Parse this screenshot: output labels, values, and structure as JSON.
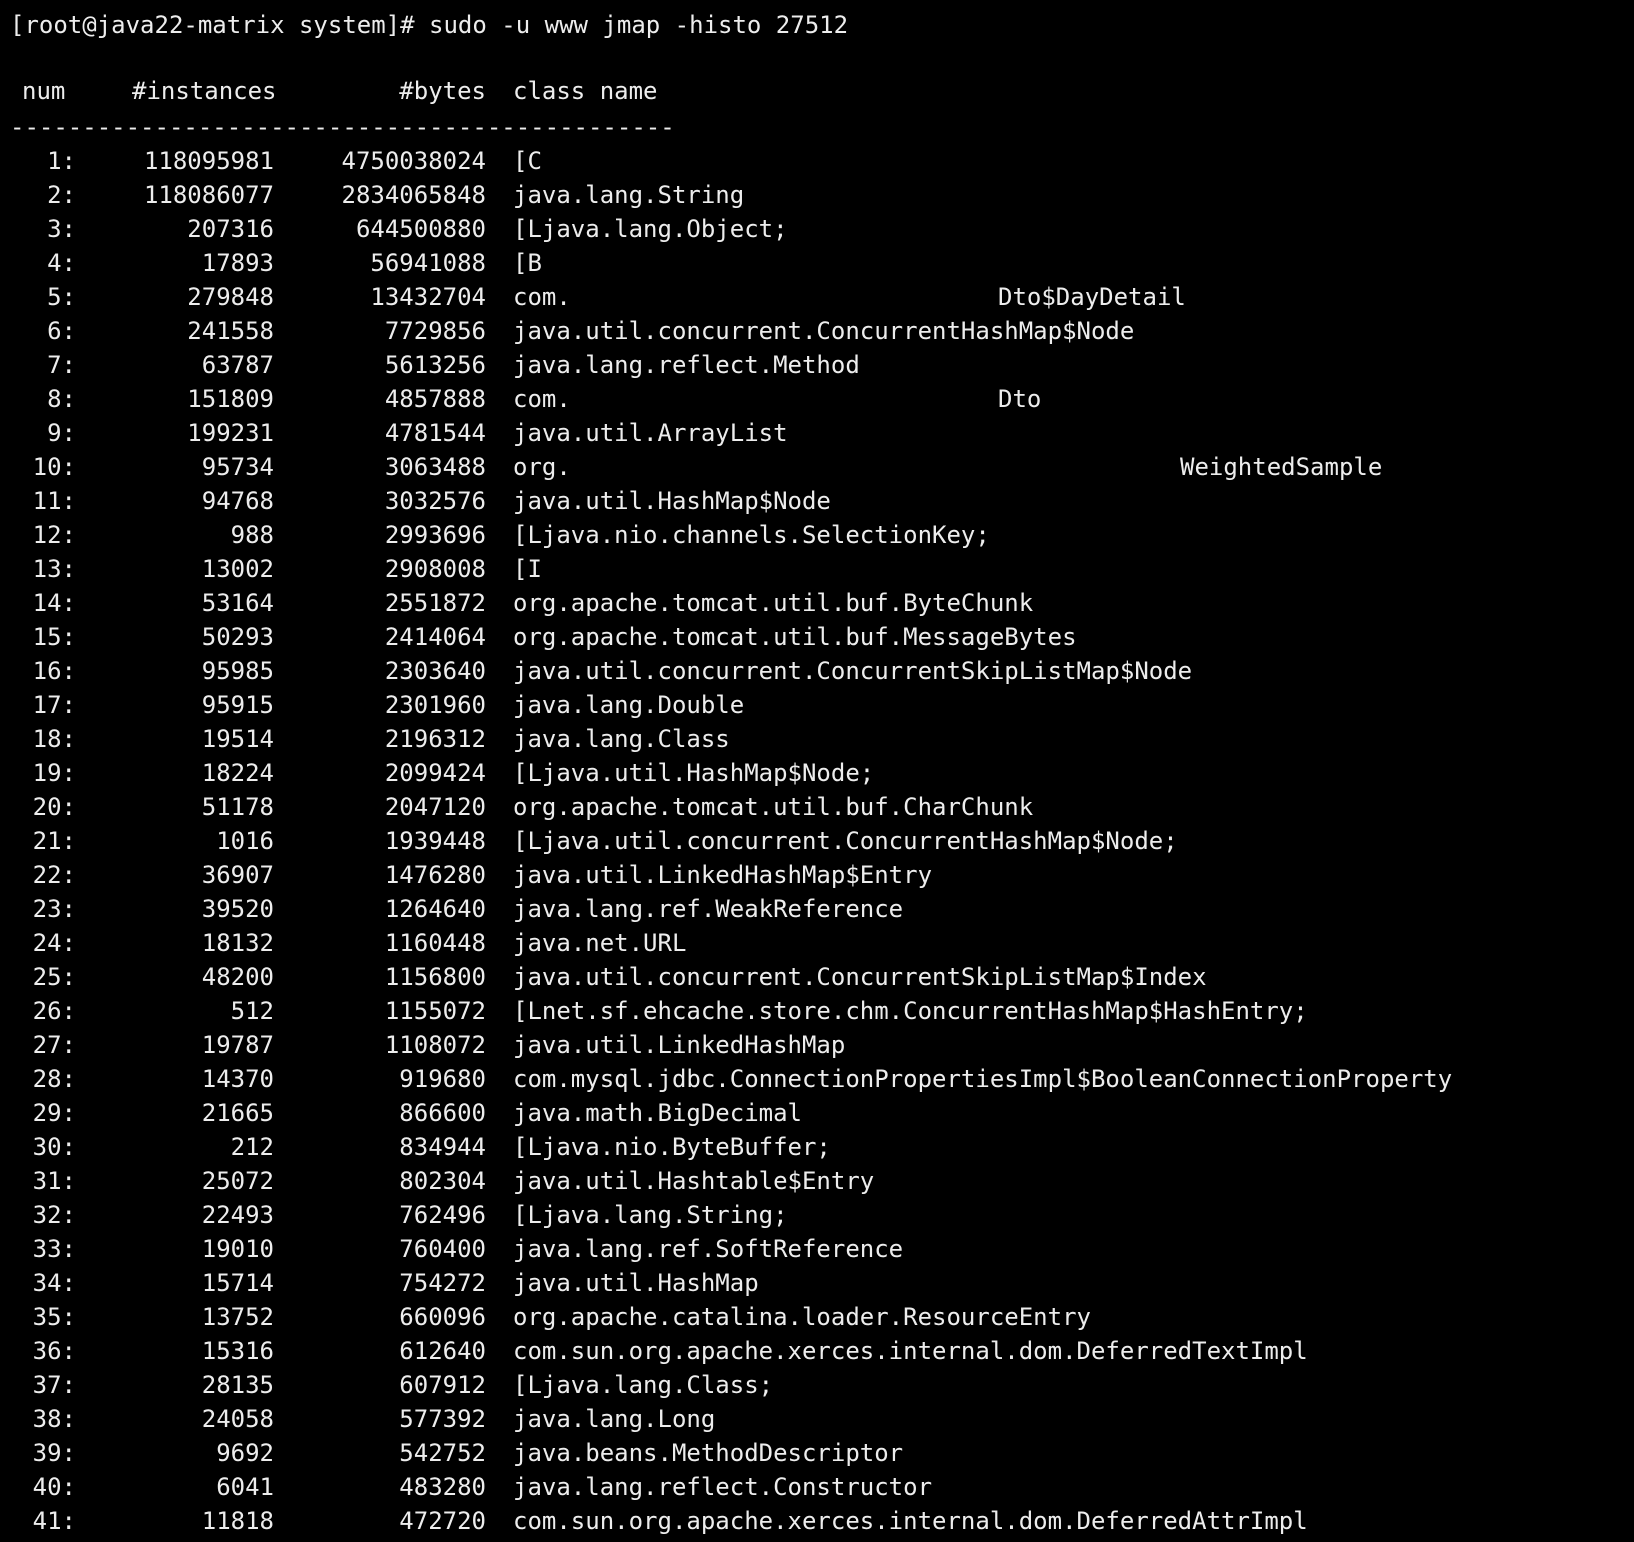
{
  "terminal": {
    "prompt": "[root@java22-matrix system]# sudo -u www jmap -histo 27512",
    "headers": {
      "num": "num",
      "instances": "#instances",
      "bytes": "#bytes",
      "class_name": "class name"
    },
    "separator": "----------------------------------------------",
    "rows": [
      {
        "num": "1:",
        "instances": "118095981",
        "bytes": "4750038024",
        "class_name": "[C"
      },
      {
        "num": "2:",
        "instances": "118086077",
        "bytes": "2834065848",
        "class_name": "java.lang.String"
      },
      {
        "num": "3:",
        "instances": "207316",
        "bytes": "644500880",
        "class_name": "[Ljava.lang.Object;"
      },
      {
        "num": "4:",
        "instances": "17893",
        "bytes": "56941088",
        "class_name": "[B"
      },
      {
        "num": "5:",
        "instances": "279848",
        "bytes": "13432704",
        "class_name": "com.",
        "class_tail": "Dto$DayDetail"
      },
      {
        "num": "6:",
        "instances": "241558",
        "bytes": "7729856",
        "class_name": "java.util.concurrent.ConcurrentHashMap$Node"
      },
      {
        "num": "7:",
        "instances": "63787",
        "bytes": "5613256",
        "class_name": "java.lang.reflect.Method"
      },
      {
        "num": "8:",
        "instances": "151809",
        "bytes": "4857888",
        "class_name": "com.",
        "class_tail": "Dto"
      },
      {
        "num": "9:",
        "instances": "199231",
        "bytes": "4781544",
        "class_name": "java.util.ArrayList"
      },
      {
        "num": "10:",
        "instances": "95734",
        "bytes": "3063488",
        "class_name": "org.",
        "class_tail": "WeightedSample"
      },
      {
        "num": "11:",
        "instances": "94768",
        "bytes": "3032576",
        "class_name": "java.util.HashMap$Node"
      },
      {
        "num": "12:",
        "instances": "988",
        "bytes": "2993696",
        "class_name": "[Ljava.nio.channels.SelectionKey;"
      },
      {
        "num": "13:",
        "instances": "13002",
        "bytes": "2908008",
        "class_name": "[I"
      },
      {
        "num": "14:",
        "instances": "53164",
        "bytes": "2551872",
        "class_name": "org.apache.tomcat.util.buf.ByteChunk"
      },
      {
        "num": "15:",
        "instances": "50293",
        "bytes": "2414064",
        "class_name": "org.apache.tomcat.util.buf.MessageBytes"
      },
      {
        "num": "16:",
        "instances": "95985",
        "bytes": "2303640",
        "class_name": "java.util.concurrent.ConcurrentSkipListMap$Node"
      },
      {
        "num": "17:",
        "instances": "95915",
        "bytes": "2301960",
        "class_name": "java.lang.Double"
      },
      {
        "num": "18:",
        "instances": "19514",
        "bytes": "2196312",
        "class_name": "java.lang.Class"
      },
      {
        "num": "19:",
        "instances": "18224",
        "bytes": "2099424",
        "class_name": "[Ljava.util.HashMap$Node;"
      },
      {
        "num": "20:",
        "instances": "51178",
        "bytes": "2047120",
        "class_name": "org.apache.tomcat.util.buf.CharChunk"
      },
      {
        "num": "21:",
        "instances": "1016",
        "bytes": "1939448",
        "class_name": "[Ljava.util.concurrent.ConcurrentHashMap$Node;"
      },
      {
        "num": "22:",
        "instances": "36907",
        "bytes": "1476280",
        "class_name": "java.util.LinkedHashMap$Entry"
      },
      {
        "num": "23:",
        "instances": "39520",
        "bytes": "1264640",
        "class_name": "java.lang.ref.WeakReference"
      },
      {
        "num": "24:",
        "instances": "18132",
        "bytes": "1160448",
        "class_name": "java.net.URL"
      },
      {
        "num": "25:",
        "instances": "48200",
        "bytes": "1156800",
        "class_name": "java.util.concurrent.ConcurrentSkipListMap$Index"
      },
      {
        "num": "26:",
        "instances": "512",
        "bytes": "1155072",
        "class_name": "[Lnet.sf.ehcache.store.chm.ConcurrentHashMap$HashEntry;"
      },
      {
        "num": "27:",
        "instances": "19787",
        "bytes": "1108072",
        "class_name": "java.util.LinkedHashMap"
      },
      {
        "num": "28:",
        "instances": "14370",
        "bytes": "919680",
        "class_name": "com.mysql.jdbc.ConnectionPropertiesImpl$BooleanConnectionProperty"
      },
      {
        "num": "29:",
        "instances": "21665",
        "bytes": "866600",
        "class_name": "java.math.BigDecimal"
      },
      {
        "num": "30:",
        "instances": "212",
        "bytes": "834944",
        "class_name": "[Ljava.nio.ByteBuffer;"
      },
      {
        "num": "31:",
        "instances": "25072",
        "bytes": "802304",
        "class_name": "java.util.Hashtable$Entry"
      },
      {
        "num": "32:",
        "instances": "22493",
        "bytes": "762496",
        "class_name": "[Ljava.lang.String;"
      },
      {
        "num": "33:",
        "instances": "19010",
        "bytes": "760400",
        "class_name": "java.lang.ref.SoftReference"
      },
      {
        "num": "34:",
        "instances": "15714",
        "bytes": "754272",
        "class_name": "java.util.HashMap"
      },
      {
        "num": "35:",
        "instances": "13752",
        "bytes": "660096",
        "class_name": "org.apache.catalina.loader.ResourceEntry"
      },
      {
        "num": "36:",
        "instances": "15316",
        "bytes": "612640",
        "class_name": "com.sun.org.apache.xerces.internal.dom.DeferredTextImpl"
      },
      {
        "num": "37:",
        "instances": "28135",
        "bytes": "607912",
        "class_name": "[Ljava.lang.Class;"
      },
      {
        "num": "38:",
        "instances": "24058",
        "bytes": "577392",
        "class_name": "java.lang.Long"
      },
      {
        "num": "39:",
        "instances": "9692",
        "bytes": "542752",
        "class_name": "java.beans.MethodDescriptor"
      },
      {
        "num": "40:",
        "instances": "6041",
        "bytes": "483280",
        "class_name": "java.lang.reflect.Constructor"
      },
      {
        "num": "41:",
        "instances": "11818",
        "bytes": "472720",
        "class_name": "com.sun.org.apache.xerces.internal.dom.DeferredAttrImpl"
      }
    ]
  },
  "colors": {
    "background": "#000000",
    "foreground": "#ededed"
  }
}
